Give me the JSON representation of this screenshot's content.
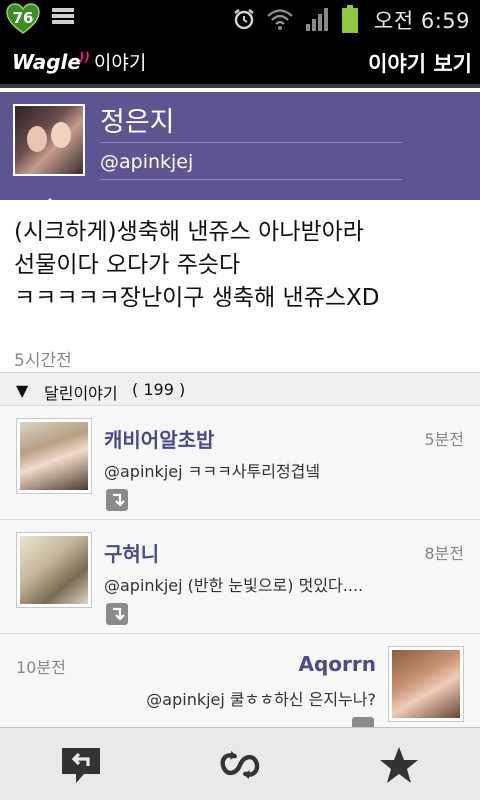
{
  "status_bar": {
    "badge": "76",
    "time": "오전 6:59",
    "battery_color": "#8dc83f"
  },
  "app": {
    "logo": "Wagle",
    "logo_sub": "이야기",
    "title": "이야기 보기"
  },
  "profile": {
    "name": "정은지",
    "handle": "@apinkjej"
  },
  "post": {
    "lines": [
      "(시크하게)생축해 낸쥬스 아나받아라",
      "선물이다 오다가 주슷다",
      "ㅋㅋㅋㅋㅋ장난이구 생축해 낸쥬스XD"
    ],
    "time": "5시간전"
  },
  "replies_section": {
    "arrow": "▼",
    "label": "달린이야기",
    "count": "( 199 )"
  },
  "replies": [
    {
      "name": "캐비어알초밥",
      "time": "5분전",
      "text": "@apinkjej ㅋㅋㅋ사투리정겹넼"
    },
    {
      "name": "구혀니",
      "time": "8분전",
      "text": "@apinkjej (반한 눈빛으로) 멋있다...."
    },
    {
      "name": "Aqorrn",
      "time": "10분전",
      "text": "@apinkjej 쿨ㅎㅎ하신 은지누나?"
    }
  ],
  "bottom_bar": {
    "icons": [
      "reply-icon",
      "retweet-icon",
      "star-icon"
    ]
  },
  "colors": {
    "profile_band": "#5d5592",
    "reply_name": "#4d4a8a",
    "accent_pink": "#e0237e"
  }
}
